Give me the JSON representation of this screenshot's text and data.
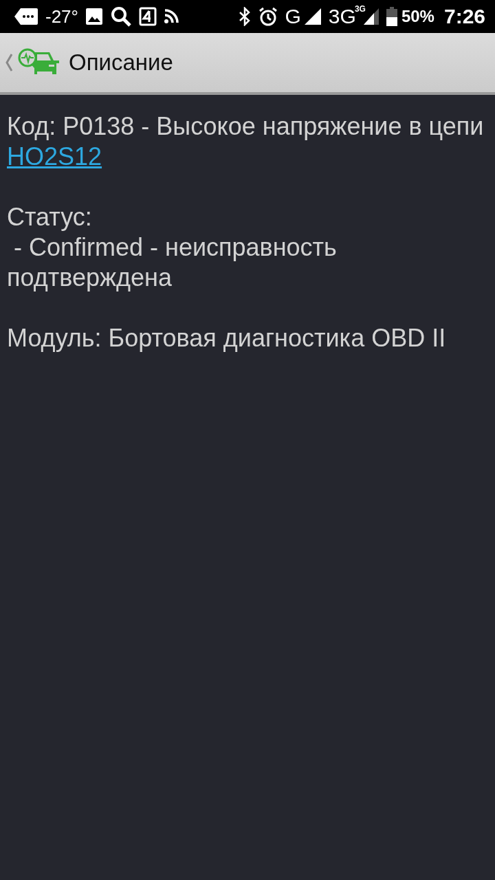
{
  "status_bar": {
    "temperature": "-27°",
    "network": "G",
    "network_2": "3G",
    "network_2_badge": "3G",
    "battery": "50%",
    "time": "7:26"
  },
  "header": {
    "title": "Описание"
  },
  "description": {
    "code_line": "Код: P0138 - Высокое напряжение в цепи",
    "link": "HO2S12",
    "status_label": "Статус:",
    "status_value": "- Confirmed - неисправность подтверждена",
    "module": "Модуль: Бортовая диагностика OBD II"
  }
}
